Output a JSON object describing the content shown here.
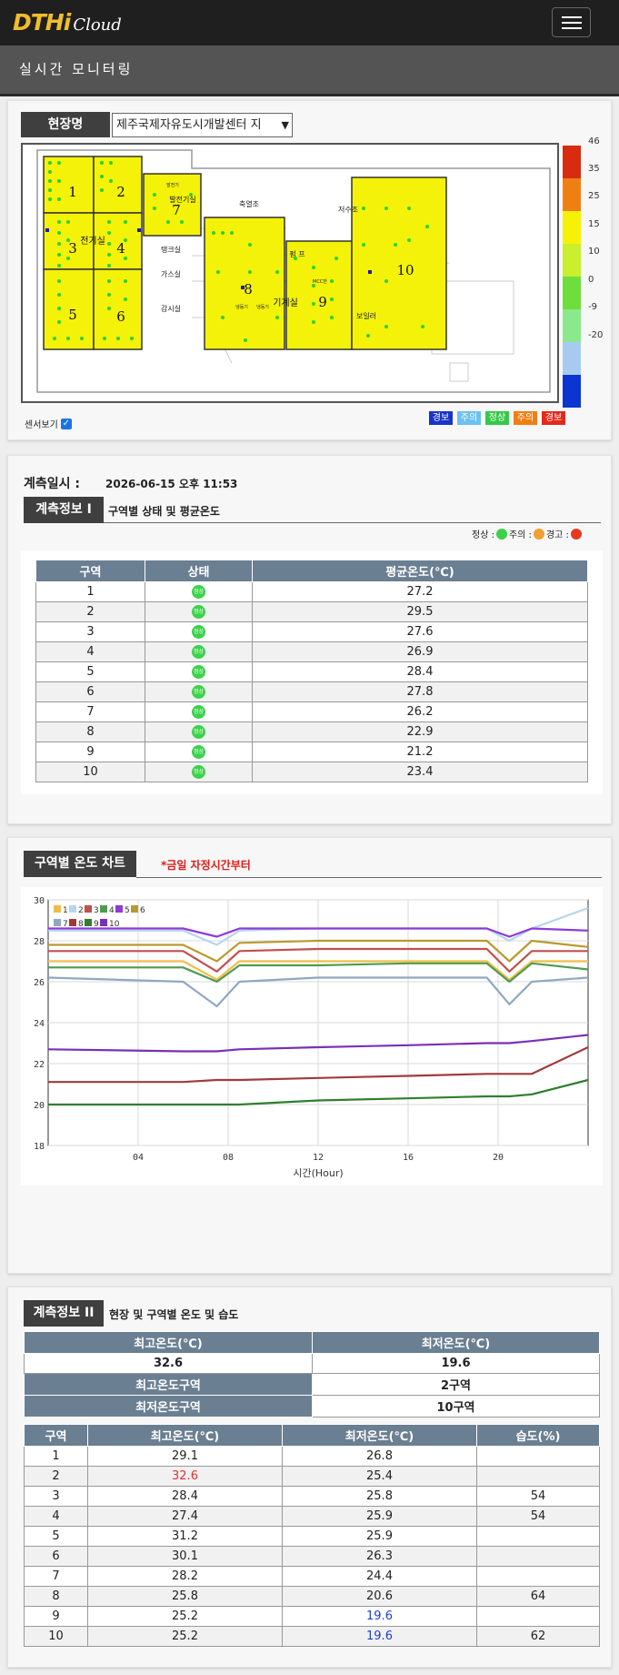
{
  "app": {
    "logo_main": "DTHi",
    "logo_cloud": "Cloud",
    "page_title": "실시간 모니터링"
  },
  "site": {
    "label": "현장명",
    "selected": "제주국제자유도시개발센터 지",
    "sensor_toggle_label": "센서보기",
    "sensor_toggle_checked": true
  },
  "floorplan": {
    "rooms": [
      "축열조",
      "저수조",
      "탱크실",
      "가스실",
      "감시실",
      "펌 프",
      "기계실",
      "보일러",
      "전기실",
      "발전기실",
      "발전기",
      "MCC반",
      "냉동기",
      "냉동기"
    ],
    "zones": [
      "1",
      "2",
      "3",
      "4",
      "5",
      "6",
      "7",
      "8",
      "9",
      "10"
    ]
  },
  "temp_scale": {
    "labels": [
      "46",
      "35",
      "25",
      "15",
      "10",
      "0",
      "-9",
      "-20"
    ],
    "colors": [
      "#d92b0f",
      "#f07f13",
      "#f7f107",
      "#c9ef2d",
      "#6ede3d",
      "#8be88d",
      "#a7cbf0",
      "#0b34d1"
    ]
  },
  "status_legend": [
    {
      "label": "경보",
      "color": "#1733c8"
    },
    {
      "label": "주의",
      "color": "#6cc1ef"
    },
    {
      "label": "정상",
      "color": "#35c84a"
    },
    {
      "label": "주의",
      "color": "#f07f13"
    },
    {
      "label": "경보",
      "color": "#e32a1c"
    }
  ],
  "measure": {
    "label": "계측일시 :",
    "datetime": "2026-06-15 오후 11:53"
  },
  "info1": {
    "title": "계측정보 I",
    "subtitle": "구역별 상태 및 평균온도",
    "legend": {
      "normal": "정상 :",
      "caution": "주의 :",
      "warning": "경고 :"
    },
    "headers": [
      "구역",
      "상태",
      "평균온도(℃)"
    ],
    "status_text": "정상",
    "rows": [
      {
        "zone": "1",
        "avg": "27.2"
      },
      {
        "zone": "2",
        "avg": "29.5"
      },
      {
        "zone": "3",
        "avg": "27.6"
      },
      {
        "zone": "4",
        "avg": "26.9"
      },
      {
        "zone": "5",
        "avg": "28.4"
      },
      {
        "zone": "6",
        "avg": "27.8"
      },
      {
        "zone": "7",
        "avg": "26.2"
      },
      {
        "zone": "8",
        "avg": "22.9"
      },
      {
        "zone": "9",
        "avg": "21.2"
      },
      {
        "zone": "10",
        "avg": "23.4"
      }
    ]
  },
  "chart_section": {
    "title": "구역별 온도 차트",
    "note": "*금일 자정시간부터"
  },
  "chart_data": {
    "type": "line",
    "xlabel": "시간(Hour)",
    "ylabel": "",
    "xlim": [
      0,
      24
    ],
    "ylim": [
      18,
      30
    ],
    "xticks": [
      "04",
      "08",
      "12",
      "16",
      "20"
    ],
    "yticks": [
      "18",
      "20",
      "22",
      "24",
      "26",
      "28",
      "30"
    ],
    "grid": true,
    "legend_position": "top-left",
    "x": [
      0,
      6,
      7.5,
      8.5,
      12,
      16,
      19.5,
      20.5,
      21.5,
      24
    ],
    "series": [
      {
        "name": "1",
        "color": "#f0bd4a",
        "values": [
          27.0,
          27.0,
          26.1,
          27.0,
          27.0,
          27.0,
          27.0,
          26.1,
          27.0,
          27.0
        ]
      },
      {
        "name": "2",
        "color": "#b5d6ee",
        "values": [
          28.5,
          28.5,
          27.8,
          28.5,
          28.6,
          28.6,
          28.6,
          28.0,
          28.6,
          29.6
        ]
      },
      {
        "name": "3",
        "color": "#c0504d",
        "values": [
          27.5,
          27.5,
          26.5,
          27.5,
          27.6,
          27.6,
          27.6,
          26.5,
          27.5,
          27.5
        ]
      },
      {
        "name": "4",
        "color": "#4f9a4f",
        "values": [
          26.7,
          26.7,
          26.0,
          26.8,
          26.8,
          26.9,
          26.9,
          26.0,
          26.9,
          26.6
        ]
      },
      {
        "name": "5",
        "color": "#8e3ad8",
        "values": [
          28.6,
          28.6,
          28.2,
          28.6,
          28.6,
          28.6,
          28.6,
          28.2,
          28.6,
          28.5
        ]
      },
      {
        "name": "6",
        "color": "#b89b2f",
        "values": [
          27.8,
          27.8,
          27.0,
          27.9,
          28.0,
          28.0,
          28.0,
          27.0,
          28.0,
          27.7
        ]
      },
      {
        "name": "7",
        "color": "#8fa8c0",
        "values": [
          26.2,
          26.0,
          24.8,
          26.0,
          26.2,
          26.2,
          26.2,
          24.9,
          26.0,
          26.2
        ]
      },
      {
        "name": "8",
        "color": "#a23a3a",
        "values": [
          21.1,
          21.1,
          21.2,
          21.2,
          21.3,
          21.4,
          21.5,
          21.5,
          21.5,
          22.8
        ]
      },
      {
        "name": "9",
        "color": "#2f7f2f",
        "values": [
          20.0,
          20.0,
          20.0,
          20.0,
          20.2,
          20.3,
          20.4,
          20.4,
          20.5,
          21.2
        ]
      },
      {
        "name": "10",
        "color": "#7a2fb8",
        "values": [
          22.7,
          22.6,
          22.6,
          22.7,
          22.8,
          22.9,
          23.0,
          23.0,
          23.1,
          23.4
        ]
      }
    ]
  },
  "info2": {
    "title": "계측정보 II",
    "subtitle": "현장 및 구역별 온도 및 습도",
    "max_label": "최고온도(℃)",
    "min_label": "최저온도(℃)",
    "max_value": "32.6",
    "min_value": "19.6",
    "max_zone_label": "최고온도구역",
    "max_zone": "2구역",
    "min_zone_label": "최저온도구역",
    "min_zone": "10구역",
    "headers": [
      "구역",
      "최고온도(℃)",
      "최저온도(℃)",
      "습도(%)"
    ],
    "rows": [
      {
        "zone": "1",
        "max": "29.1",
        "min": "26.8",
        "hum": ""
      },
      {
        "zone": "2",
        "max": "32.6",
        "min": "25.4",
        "hum": ""
      },
      {
        "zone": "3",
        "max": "28.4",
        "min": "25.8",
        "hum": "54"
      },
      {
        "zone": "4",
        "max": "27.4",
        "min": "25.9",
        "hum": "54"
      },
      {
        "zone": "5",
        "max": "31.2",
        "min": "25.9",
        "hum": ""
      },
      {
        "zone": "6",
        "max": "30.1",
        "min": "26.3",
        "hum": ""
      },
      {
        "zone": "7",
        "max": "28.2",
        "min": "24.4",
        "hum": ""
      },
      {
        "zone": "8",
        "max": "25.8",
        "min": "20.6",
        "hum": "64"
      },
      {
        "zone": "9",
        "max": "25.2",
        "min": "19.6",
        "hum": ""
      },
      {
        "zone": "10",
        "max": "25.2",
        "min": "19.6",
        "hum": "62"
      }
    ]
  }
}
